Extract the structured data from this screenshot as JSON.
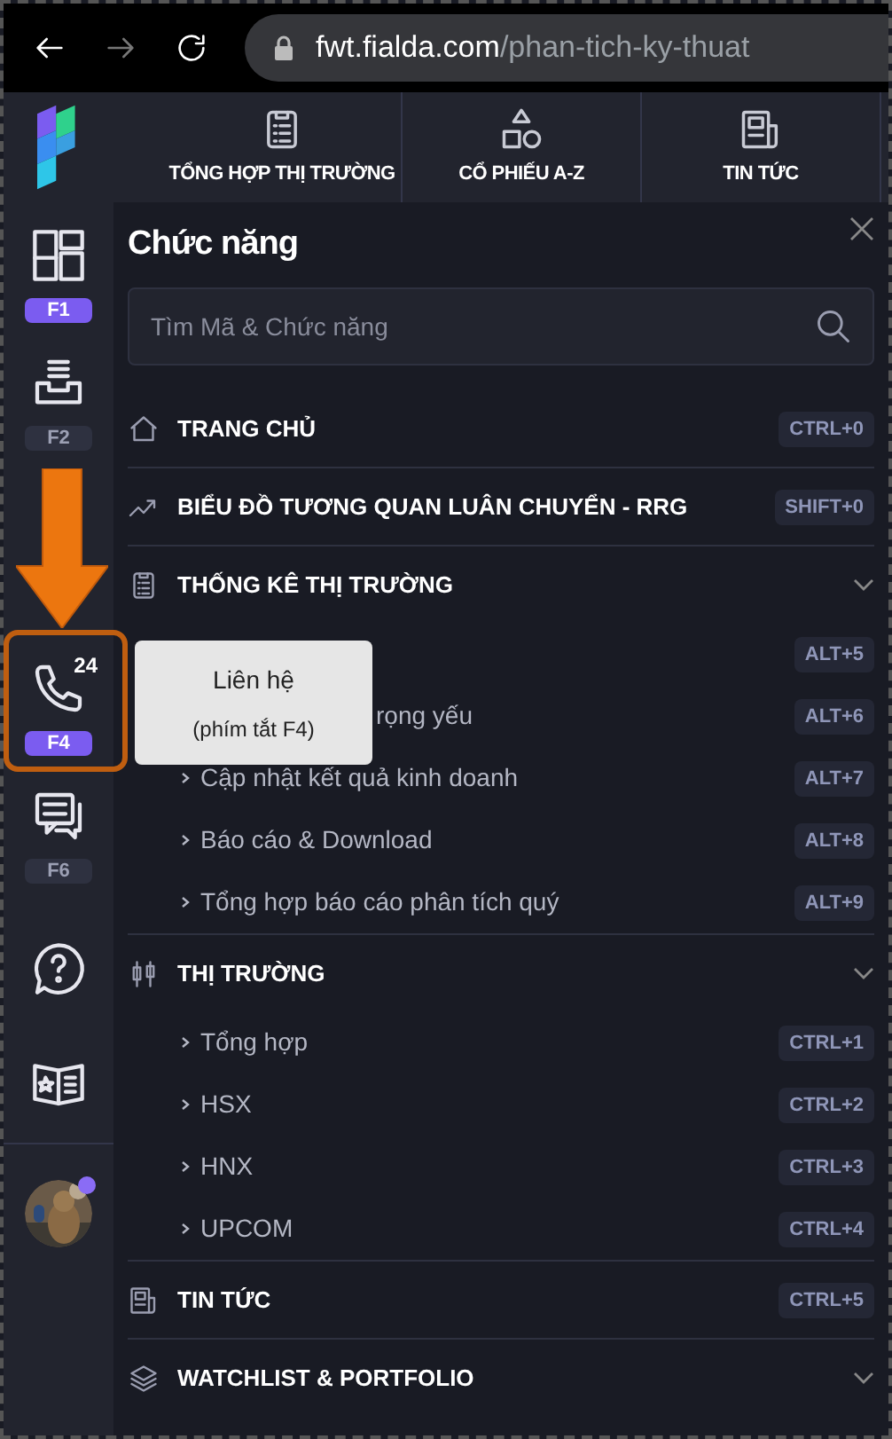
{
  "browser": {
    "url_host": "fwt.fialda.com",
    "url_path": "/phan-tich-ky-thuat"
  },
  "top_tabs": [
    {
      "label": "TỔNG HỢP THỊ TRƯỜNG"
    },
    {
      "label": "CỔ PHIẾU A-Z"
    },
    {
      "label": "TIN TỨC"
    }
  ],
  "sidebar": [
    {
      "kind": "keyed",
      "key": "F1",
      "selected": true
    },
    {
      "kind": "keyed",
      "key": "F2",
      "selected": false
    },
    {
      "kind": "keyed",
      "badge": "24",
      "key": "F4",
      "selected": true
    },
    {
      "kind": "keyed",
      "key": "F6",
      "selected": false
    },
    {
      "kind": "plain"
    },
    {
      "kind": "plain"
    }
  ],
  "tooltip": {
    "title": "Liên hệ",
    "hint": "(phím tắt F4)"
  },
  "panel": {
    "title": "Chức năng",
    "search": {
      "placeholder": "Tìm Mã & Chức năng"
    }
  },
  "menu": [
    {
      "kind": "link",
      "label": "TRANG CHỦ",
      "shortcut": "CTRL+0"
    },
    {
      "kind": "link",
      "label": "BIỂU ĐỒ TƯƠNG QUAN LUÂN CHUYỂN - RRG",
      "shortcut": "SHIFT+0"
    },
    {
      "kind": "group",
      "label": "THỐNG KÊ THỊ TRƯỜNG",
      "children": [
        {
          "kind": "covered",
          "shortcut": "ALT+5"
        },
        {
          "kind": "covered",
          "label": "rọng yếu",
          "shortcut": "ALT+6"
        },
        {
          "kind": "item",
          "label": "Cập nhật kết quả kinh doanh",
          "shortcut": "ALT+7"
        },
        {
          "kind": "item",
          "label": "Báo cáo & Download",
          "shortcut": "ALT+8"
        },
        {
          "kind": "item",
          "label": "Tổng hợp báo cáo phân tích quý",
          "shortcut": "ALT+9"
        }
      ]
    },
    {
      "kind": "group",
      "label": "THỊ TRƯỜNG",
      "children": [
        {
          "kind": "item",
          "label": "Tổng hợp",
          "shortcut": "CTRL+1"
        },
        {
          "kind": "item",
          "label": "HSX",
          "shortcut": "CTRL+2"
        },
        {
          "kind": "item",
          "label": "HNX",
          "shortcut": "CTRL+3"
        },
        {
          "kind": "item",
          "label": "UPCOM",
          "shortcut": "CTRL+4"
        }
      ]
    },
    {
      "kind": "link",
      "label": "TIN TỨC",
      "shortcut": "CTRL+5"
    },
    {
      "kind": "group",
      "label": "WATCHLIST & PORTFOLIO"
    }
  ]
}
